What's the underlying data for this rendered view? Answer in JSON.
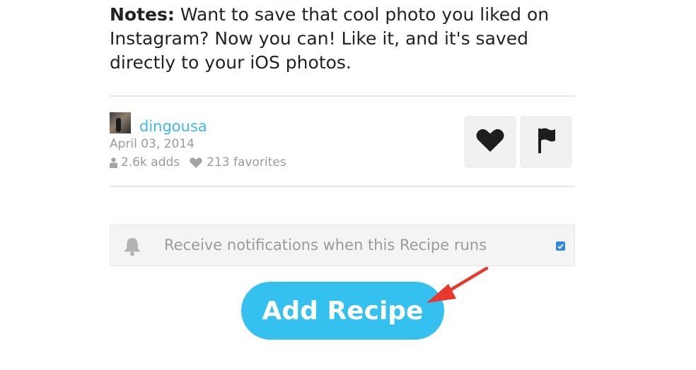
{
  "notes": {
    "label": "Notes:",
    "text": " Want to save that cool photo you liked on Instagram? Now you can! Like it, and it's saved directly to your iOS photos."
  },
  "author": {
    "username": "dingousa",
    "date": "April 03, 2014",
    "adds": "2.6k adds",
    "favorites": "213 favorites"
  },
  "actions": {
    "favorite_icon": "heart-icon",
    "flag_icon": "flag-icon"
  },
  "notification": {
    "label": "Receive notifications when this Recipe runs",
    "checked": true
  },
  "cta": {
    "label": "Add Recipe"
  },
  "colors": {
    "accent": "#34c1f0",
    "link": "#3fb8e6",
    "checkbox": "#2f86ea",
    "annotation_arrow": "#e8392f"
  }
}
